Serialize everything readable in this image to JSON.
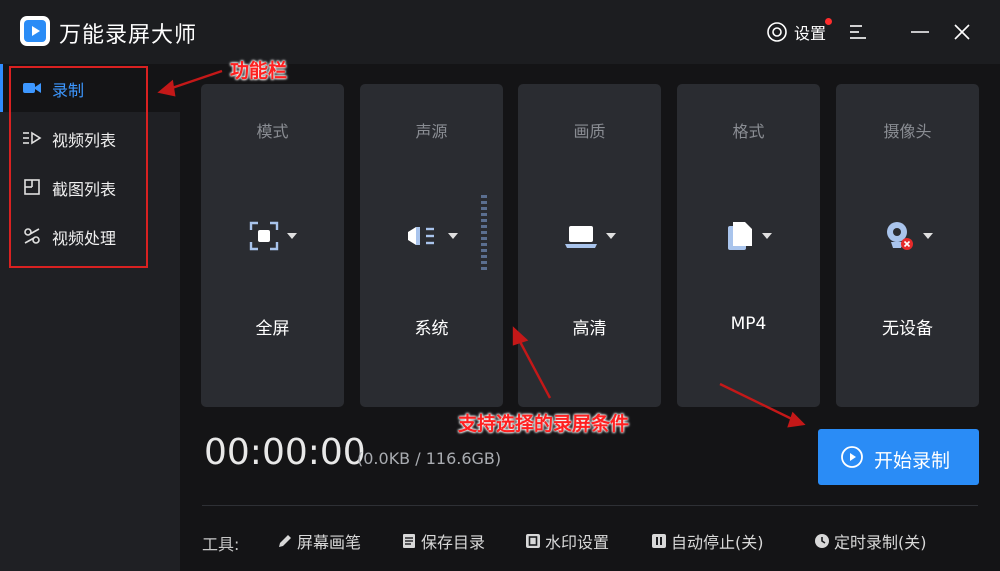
{
  "app": {
    "title": "万能录屏大师"
  },
  "header": {
    "settings_label": "设置"
  },
  "sidebar": {
    "items": [
      {
        "label": "录制",
        "icon": "video-camera-icon",
        "active": true
      },
      {
        "label": "视频列表",
        "icon": "video-list-icon"
      },
      {
        "label": "截图列表",
        "icon": "screenshot-list-icon"
      },
      {
        "label": "视频处理",
        "icon": "video-processing-icon"
      }
    ]
  },
  "cards": [
    {
      "title": "模式",
      "value": "全屏",
      "icon": "fullscreen-icon"
    },
    {
      "title": "声源",
      "value": "系统",
      "icon": "speaker-icon"
    },
    {
      "title": "画质",
      "value": "高清",
      "icon": "laptop-icon"
    },
    {
      "title": "格式",
      "value": "MP4",
      "icon": "file-icon"
    },
    {
      "title": "摄像头",
      "value": "无设备",
      "icon": "webcam-icon"
    }
  ],
  "recording": {
    "timer": "00:00:00",
    "storage": "(0.0KB / 116.6GB)",
    "start_label": "开始录制"
  },
  "tools": {
    "label": "工具:",
    "items": [
      {
        "label": "屏幕画笔",
        "icon": "pen-icon"
      },
      {
        "label": "保存目录",
        "icon": "folder-icon"
      },
      {
        "label": "水印设置",
        "icon": "watermark-icon"
      },
      {
        "label": "自动停止(关)",
        "icon": "pause-icon"
      },
      {
        "label": "定时录制(关)",
        "icon": "clock-icon"
      }
    ]
  },
  "annotations": {
    "sidebar_note": "功能栏",
    "conditions_note": "支持选择的录屏条件"
  },
  "colors": {
    "accent": "#2a8cf6",
    "active_text": "#3d97ff",
    "annotation": "#ff2020",
    "background": "#141416",
    "card": "#2a2c31"
  }
}
